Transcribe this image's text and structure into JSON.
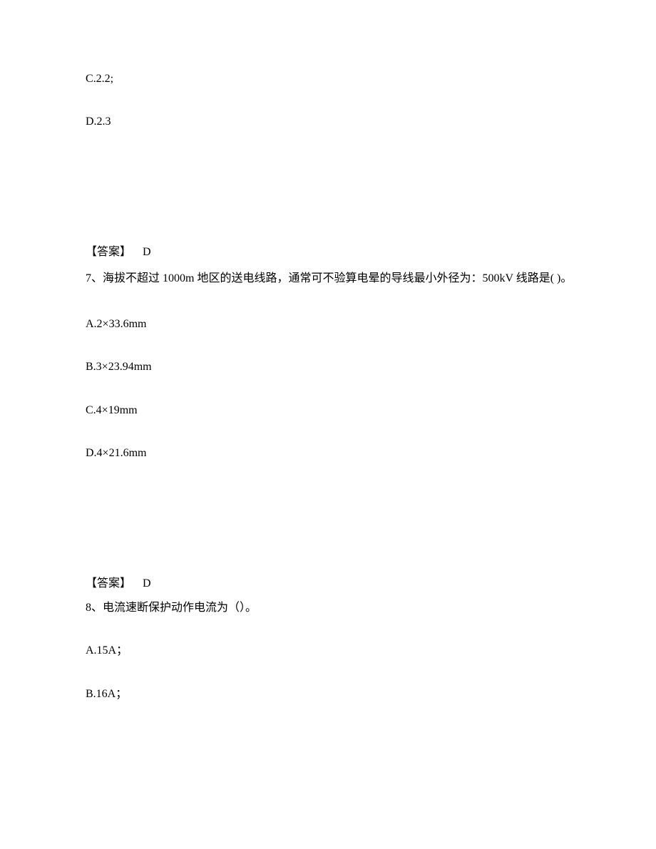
{
  "q6": {
    "optC": "C.2.2;",
    "optD": "D.2.3",
    "answerLabel": "【答案】",
    "answerLetter": "D"
  },
  "q7": {
    "stem": "7、海拔不超过 1000m 地区的送电线路，通常可不验算电晕的导线最小外径为：500kV 线路是( )。",
    "optA": "A.2×33.6mm",
    "optB": "B.3×23.94mm",
    "optC": "C.4×19mm",
    "optD": "D.4×21.6mm",
    "answerLabel": "【答案】",
    "answerLetter": "D"
  },
  "q8": {
    "stem": "8、电流速断保护动作电流为（）。",
    "optA": "A.15A；",
    "optB": "B.16A；"
  }
}
